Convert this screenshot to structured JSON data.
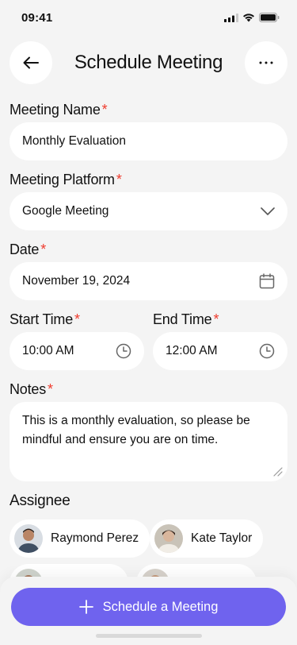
{
  "status_bar": {
    "time": "09:41"
  },
  "header": {
    "title": "Schedule Meeting"
  },
  "form": {
    "meeting_name": {
      "label": "Meeting Name",
      "value": "Monthly Evaluation",
      "required": "*"
    },
    "platform": {
      "label": "Meeting Platform",
      "value": "Google Meeting",
      "required": "*"
    },
    "date": {
      "label": "Date",
      "value": "November 19, 2024",
      "required": "*"
    },
    "start_time": {
      "label": "Start Time",
      "value": "10:00 AM",
      "required": "*"
    },
    "end_time": {
      "label": "End Time",
      "value": "12:00 AM",
      "required": "*"
    },
    "notes": {
      "label": "Notes",
      "value": "This is a monthly evaluation, so please be mindful and ensure you are on time.",
      "required": "*"
    }
  },
  "assignee": {
    "label": "Assignee",
    "people": [
      {
        "name": "Raymond Perez"
      },
      {
        "name": "Kate Taylor"
      }
    ]
  },
  "cta": {
    "label": "Schedule a Meeting"
  },
  "colors": {
    "accent": "#6f63ee",
    "required": "#ef3b2d",
    "background": "#f4f4f4"
  }
}
